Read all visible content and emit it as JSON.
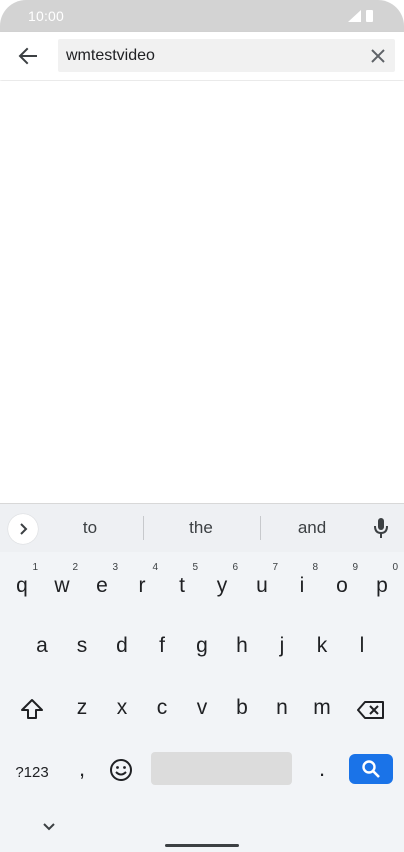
{
  "status_bar": {
    "time": "10:00"
  },
  "search": {
    "value": "wmtestvideo"
  },
  "keyboard": {
    "suggestions": [
      "to",
      "the",
      "and"
    ],
    "row1": [
      {
        "char": "q",
        "num": "1"
      },
      {
        "char": "w",
        "num": "2"
      },
      {
        "char": "e",
        "num": "3"
      },
      {
        "char": "r",
        "num": "4"
      },
      {
        "char": "t",
        "num": "5"
      },
      {
        "char": "y",
        "num": "6"
      },
      {
        "char": "u",
        "num": "7"
      },
      {
        "char": "i",
        "num": "8"
      },
      {
        "char": "o",
        "num": "9"
      },
      {
        "char": "p",
        "num": "0"
      }
    ],
    "row2": [
      "a",
      "s",
      "d",
      "f",
      "g",
      "h",
      "j",
      "k",
      "l"
    ],
    "row3": [
      "z",
      "x",
      "c",
      "v",
      "b",
      "n",
      "m"
    ],
    "symbols_label": "?123",
    "comma": ",",
    "period": ".",
    "icons": {
      "expand": "chevron-right-icon",
      "mic": "microphone-icon",
      "shift": "shift-icon",
      "backspace": "backspace-icon",
      "emoji": "emoji-icon",
      "search": "search-icon",
      "hide": "chevron-down-icon"
    },
    "accent_color": "#1a73e8"
  }
}
